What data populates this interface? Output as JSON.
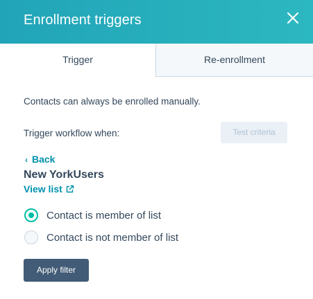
{
  "panel": {
    "title": "Enrollment triggers",
    "close_icon": "close-icon"
  },
  "tabs": [
    {
      "label": "Trigger",
      "active": true
    },
    {
      "label": "Re-enrollment",
      "active": false
    }
  ],
  "content": {
    "manual_note": "Contacts can always be enrolled manually.",
    "trigger_label": "Trigger workflow when:",
    "test_button": "Test criteria",
    "back_label": "Back",
    "back_icon": "chevron-left-icon",
    "list_name": "New YorkUsers",
    "view_list_label": "View list",
    "view_list_icon": "external-link-icon"
  },
  "options": [
    {
      "label": "Contact is member of list",
      "selected": true
    },
    {
      "label": "Contact is not member of list",
      "selected": false
    }
  ],
  "apply_button": "Apply filter",
  "colors": {
    "header": "#21a4b8",
    "accent": "#00bda5",
    "link": "#0091ae",
    "primary_button": "#425b76",
    "text": "#33475b"
  }
}
